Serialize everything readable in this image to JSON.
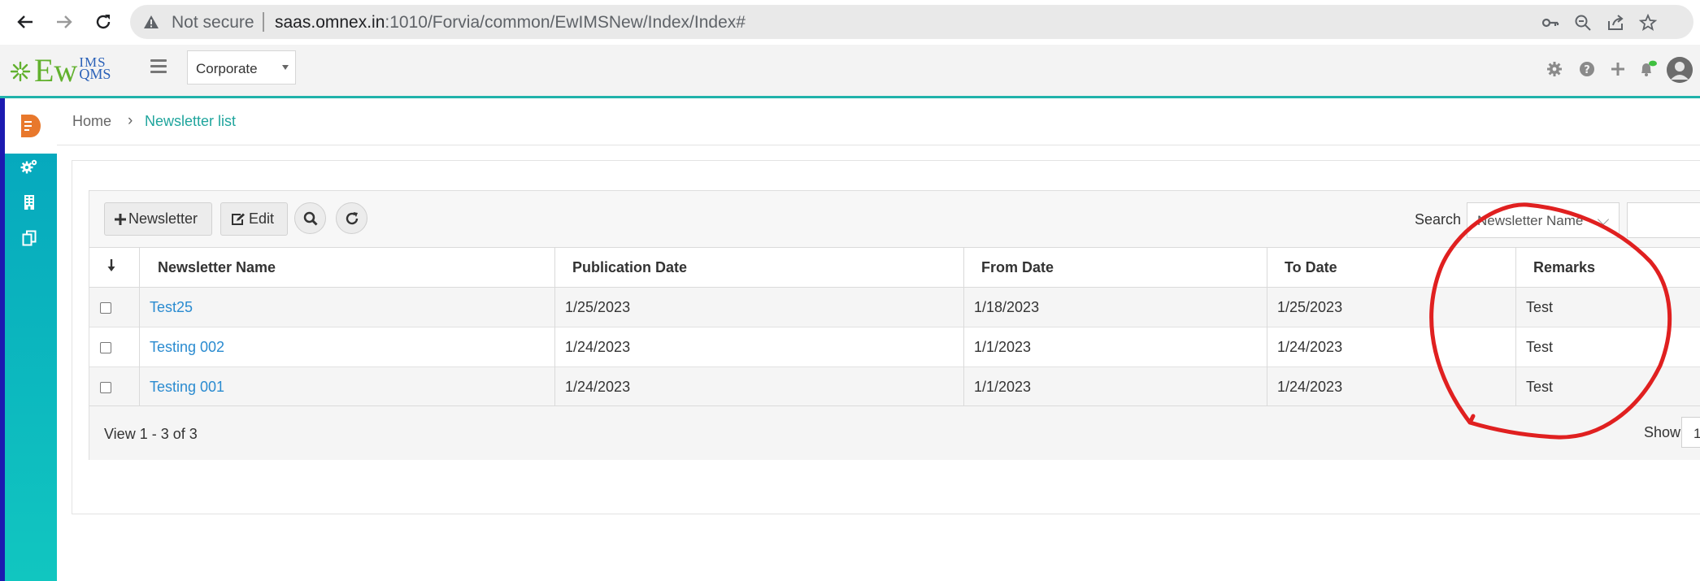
{
  "browser": {
    "not_secure": "Not secure",
    "url_host": "saas.omnex.in",
    "url_rest": ":1010/Forvia/common/EwIMSNew/Index/Index#"
  },
  "header": {
    "logo_ew": "Ew",
    "logo_ims": "IMS",
    "logo_qms": "QMS",
    "company_select": "Corporate",
    "icons": [
      "gear-icon",
      "help-icon",
      "plus-icon",
      "bell-icon",
      "avatar"
    ]
  },
  "sidebar": {
    "items": [
      "document-icon",
      "gears-icon",
      "building-icon",
      "copy-icon"
    ]
  },
  "breadcrumb": {
    "home": "Home",
    "separator": "›",
    "current": "Newsletter list"
  },
  "toolbar": {
    "newsletter_label": "Newsletter",
    "edit_label": "Edit",
    "search_label": "Search",
    "search_field": "Newsletter Name"
  },
  "table": {
    "columns": [
      "Newsletter Name",
      "Publication Date",
      "From Date",
      "To Date",
      "Remarks"
    ],
    "rows": [
      {
        "name": "Test25",
        "publication": "1/25/2023",
        "from": "1/18/2023",
        "to": "1/25/2023",
        "remarks": "Test"
      },
      {
        "name": "Testing 002",
        "publication": "1/24/2023",
        "from": "1/1/2023",
        "to": "1/24/2023",
        "remarks": "Test"
      },
      {
        "name": "Testing 001",
        "publication": "1/24/2023",
        "from": "1/1/2023",
        "to": "1/24/2023",
        "remarks": "Test"
      }
    ]
  },
  "pager": {
    "view_text": "View 1 - 3 of 3",
    "show_label": "Show",
    "show_value": "1"
  },
  "colors": {
    "accent": "#20b2aa",
    "link": "#2a8bd0",
    "annotation": "#e02020"
  }
}
